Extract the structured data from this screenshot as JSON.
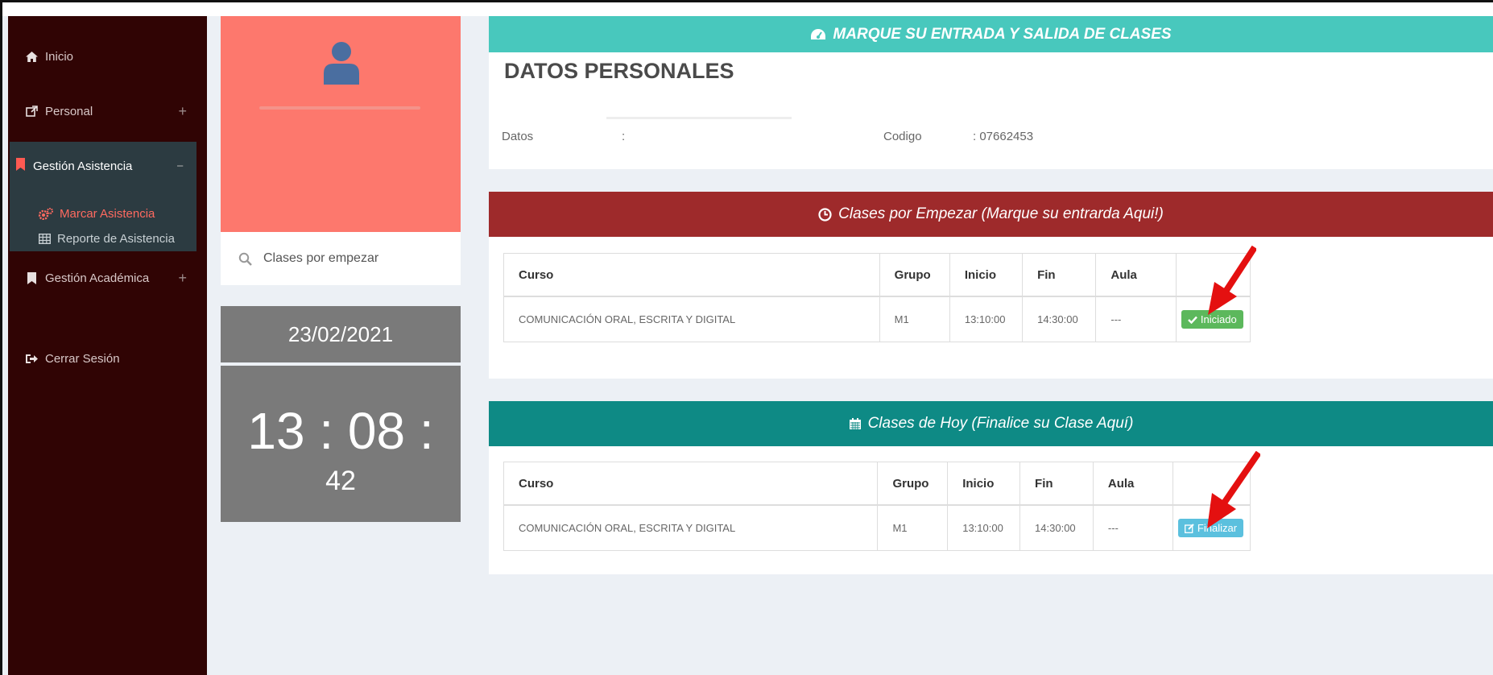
{
  "sidebar": {
    "items": [
      {
        "label": "Inicio",
        "icon": "home-icon"
      },
      {
        "label": "Personal",
        "icon": "external-link-icon",
        "toggle": "+"
      },
      {
        "label": "Gestión Asistencia",
        "icon": "bookmark-icon",
        "toggle": "−"
      },
      {
        "label": "Gestión Académica",
        "icon": "bookmark-icon",
        "toggle": "+"
      },
      {
        "label": "Cerrar Sesión",
        "icon": "sign-out-icon"
      }
    ],
    "submenu": [
      {
        "label": "Marcar Asistencia",
        "icon": "cogs-icon",
        "active": true
      },
      {
        "label": "Reporte de Asistencia",
        "icon": "table-icon"
      }
    ]
  },
  "left": {
    "search_label": "Clases por empezar",
    "date": "23/02/2021",
    "clock_main": "13 : 08 :",
    "clock_sec": "42"
  },
  "main": {
    "banner": "MARQUE SU ENTRADA Y SALIDA DE CLASES",
    "datos_title": "DATOS PERSONALES",
    "datos_label": "Datos",
    "datos_sep": ":",
    "codigo_label": "Codigo",
    "codigo_value": ": 07662453"
  },
  "panel1": {
    "title": "Clases por Empezar (Marque su entrarda Aqui!)",
    "headers": [
      "Curso",
      "Grupo",
      "Inicio",
      "Fin",
      "Aula",
      ""
    ],
    "row": [
      "COMUNICACIÓN ORAL, ESCRITA Y DIGITAL",
      "M1",
      "13:10:00",
      "14:30:00",
      "---"
    ],
    "button": "Iniciado"
  },
  "panel2": {
    "title": "Clases de Hoy (Finalice su Clase Aquí)",
    "headers": [
      "Curso",
      "Grupo",
      "Inicio",
      "Fin",
      "Aula",
      ""
    ],
    "row": [
      "COMUNICACIÓN ORAL, ESCRITA Y DIGITAL",
      "M1",
      "13:10:00",
      "14:30:00",
      "---"
    ],
    "button": "Finalizar"
  },
  "colors": {
    "sidebar": "#300404",
    "profile": "#fd786d",
    "banner": "#48c8bd",
    "panel1_head": "#9e2a2b",
    "panel2_head": "#0e8a85",
    "btn_success": "#5cb85c",
    "btn_info": "#5bc0de",
    "arrow": "#e41010"
  }
}
